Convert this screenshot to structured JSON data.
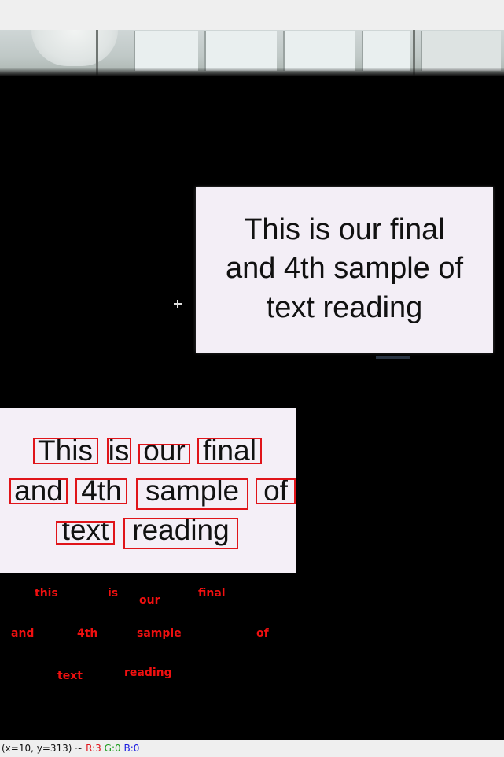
{
  "camera_card": {
    "lines": [
      "This is our final",
      "and 4th sample of",
      "text reading"
    ]
  },
  "detected_words": [
    {
      "id": "this",
      "text": "This"
    },
    {
      "id": "is",
      "text": "is"
    },
    {
      "id": "our",
      "text": "our"
    },
    {
      "id": "final",
      "text": "final"
    },
    {
      "id": "and",
      "text": "and"
    },
    {
      "id": "4th",
      "text": "4th"
    },
    {
      "id": "sample",
      "text": "sample"
    },
    {
      "id": "of",
      "text": "of"
    },
    {
      "id": "text",
      "text": "text"
    },
    {
      "id": "reading",
      "text": "reading"
    }
  ],
  "ocr_labels": [
    "this",
    "is",
    "our",
    "final",
    "and",
    "4th",
    "sample",
    "of",
    "text",
    "reading"
  ],
  "status": {
    "coords": "(x=10, y=313) ~ ",
    "r": "R:3",
    "g": "G:0",
    "b": "B:0"
  },
  "colors": {
    "box": "#e0141a",
    "ocr_text": "#f01010",
    "toolbar_bg": "#efefef"
  }
}
